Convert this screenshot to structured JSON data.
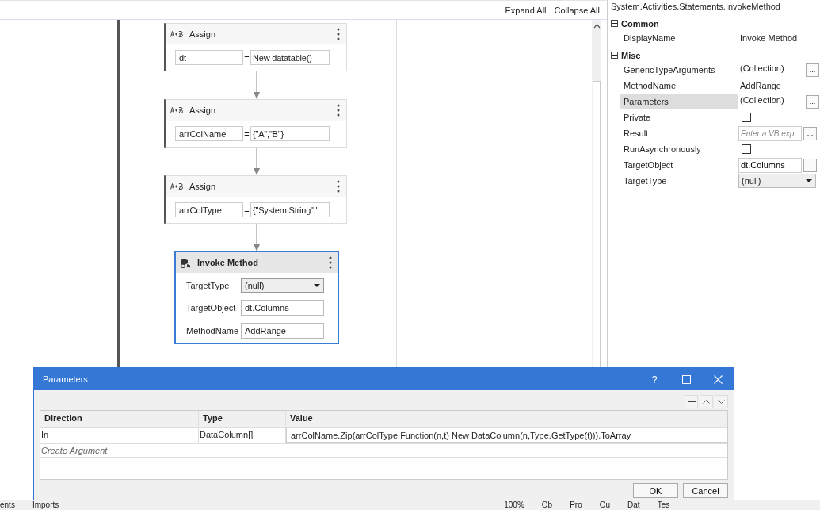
{
  "designer": {
    "toolbar": [
      {
        "label": "Expand All"
      },
      {
        "label": "Collapse All"
      }
    ],
    "activities": [
      {
        "kind": "assign",
        "title": "Assign",
        "selected": false,
        "to": "dt",
        "operator": "=",
        "value": "New datatable()"
      },
      {
        "kind": "assign",
        "title": "Assign",
        "selected": false,
        "to": "arrColName",
        "operator": "=",
        "value": "{\"A\",\"B\"}"
      },
      {
        "kind": "assign",
        "title": "Assign",
        "selected": false,
        "to": "arrColType",
        "operator": "=",
        "value": "{\"System.String\",\""
      },
      {
        "kind": "invoke_method",
        "title": "Invoke Method",
        "selected": true,
        "fields": [
          {
            "kind": "dropdown",
            "label": "TargetType",
            "value": "(null)"
          },
          {
            "kind": "text",
            "label": "TargetObject",
            "value": "dt.Columns"
          },
          {
            "kind": "text",
            "label": "MethodName",
            "value": "AddRange"
          }
        ]
      }
    ]
  },
  "properties": {
    "title": "System.Activities.Statements.InvokeMethod",
    "categories": [
      {
        "name": "Common",
        "expanded": true,
        "rows": [
          {
            "kind": "text",
            "name": "DisplayName",
            "value": "Invoke Method",
            "selected": false
          }
        ]
      },
      {
        "name": "Misc",
        "expanded": true,
        "rows": [
          {
            "kind": "collection",
            "name": "GenericTypeArguments",
            "value": "(Collection)",
            "button": "...",
            "selected": false
          },
          {
            "kind": "text",
            "name": "MethodName",
            "value": "AddRange",
            "selected": false
          },
          {
            "kind": "collection",
            "name": "Parameters",
            "value": "(Collection)",
            "button": "...",
            "selected": true
          },
          {
            "kind": "checkbox",
            "name": "Private",
            "checked": false,
            "selected": false
          },
          {
            "kind": "expression",
            "name": "Result",
            "placeholder": "Enter a VB exp",
            "button": "...",
            "selected": false
          },
          {
            "kind": "checkbox",
            "name": "RunAsynchronously",
            "checked": false,
            "selected": false
          },
          {
            "kind": "expression",
            "name": "TargetObject",
            "value": "dt.Columns",
            "button": "...",
            "selected": false
          },
          {
            "kind": "dropdown",
            "name": "TargetType",
            "value": "(null)",
            "selected": false
          }
        ]
      }
    ]
  },
  "dialog": {
    "title": "Parameters",
    "help": "?",
    "columns": [
      "Direction",
      "Type",
      "Value"
    ],
    "rows": [
      {
        "direction": "In",
        "type": "DataColumn[]",
        "value": "arrColName.Zip(arrColType,Function(n,t) New DataColumn(n,Type.GetType(t))).ToArray"
      }
    ],
    "create_placeholder": "Create Argument",
    "buttons": [
      "OK",
      "Cancel"
    ]
  },
  "status_bar": [
    "ents",
    "Imports",
    "100%",
    "Ob",
    "Pro",
    "Ou",
    "Dat",
    "Tes"
  ]
}
